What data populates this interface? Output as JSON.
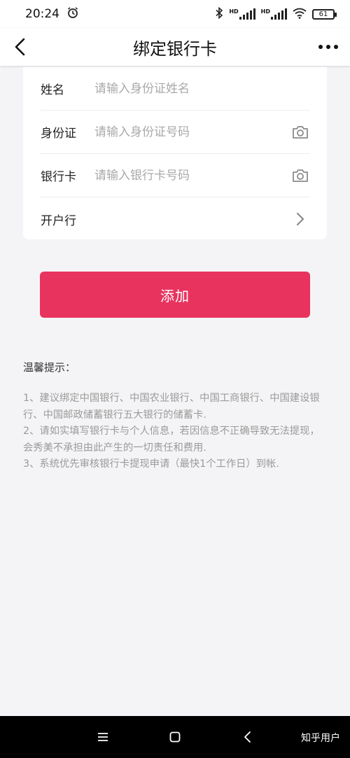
{
  "status_bar": {
    "time": "20:24",
    "battery": "61",
    "network_labels": [
      "HD",
      "HD"
    ]
  },
  "nav": {
    "title": "绑定银行卡"
  },
  "form": {
    "name": {
      "label": "姓名",
      "placeholder": "请输入身份证姓名"
    },
    "id_card": {
      "label": "身份证",
      "placeholder": "请输入身份证号码"
    },
    "bank_card": {
      "label": "银行卡",
      "placeholder": "请输入银行卡号码"
    },
    "bank": {
      "label": "开户行"
    }
  },
  "add_button": {
    "label": "添加",
    "color": "#e8335f"
  },
  "tips": {
    "title": "温馨提示：",
    "items": [
      "1、建议绑定中国银行、中国农业银行、中国工商银行、中国建设银行、中国邮政储蓄银行五大银行的储蓄卡.",
      "2、请如实填写银行卡与个人信息，若因信息不正确导致无法提现，会秀美不承担由此产生的一切责任和费用.",
      "3、系统优先审核银行卡提现申请（最快1个工作日）到帐."
    ]
  },
  "watermark": "知乎用户"
}
